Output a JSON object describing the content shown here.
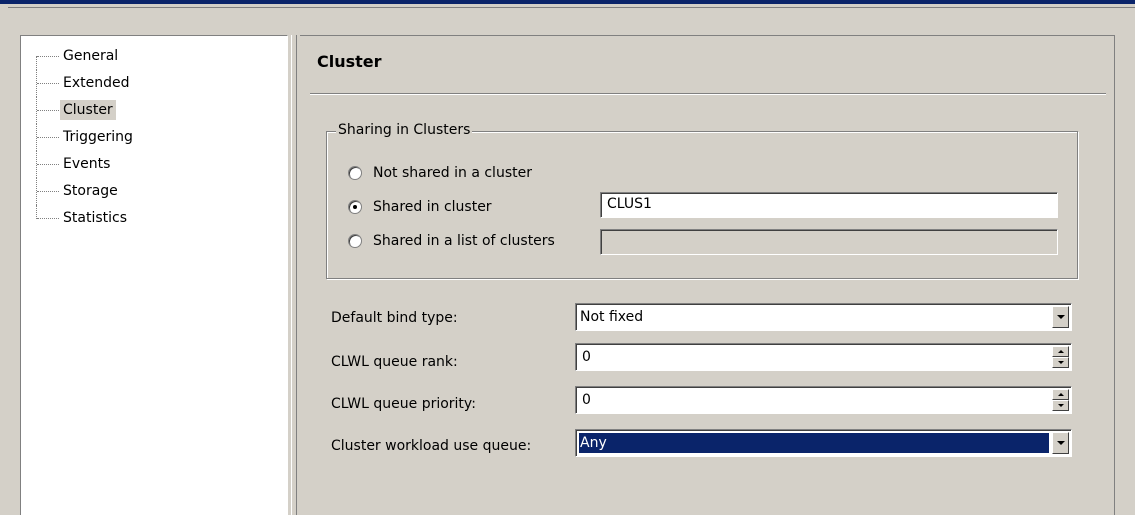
{
  "tree": {
    "items": [
      {
        "label": "General"
      },
      {
        "label": "Extended"
      },
      {
        "label": "Cluster"
      },
      {
        "label": "Triggering"
      },
      {
        "label": "Events"
      },
      {
        "label": "Storage"
      },
      {
        "label": "Statistics"
      }
    ],
    "selected": "Cluster"
  },
  "panel": {
    "title": "Cluster",
    "sharing": {
      "legend": "Sharing in Clusters",
      "options": [
        {
          "label": "Not shared in a cluster",
          "checked": false
        },
        {
          "label": "Shared in cluster",
          "checked": true
        },
        {
          "label": "Shared in a list of clusters",
          "checked": false
        }
      ],
      "cluster_name_value": "CLUS1",
      "cluster_list_value": ""
    },
    "fields": {
      "default_bind_type": {
        "label": "Default bind type:",
        "value": "Not fixed"
      },
      "clwl_queue_rank": {
        "label": "CLWL queue rank:",
        "value": "0"
      },
      "clwl_queue_priority": {
        "label": "CLWL queue priority:",
        "value": "0"
      },
      "cluster_workload_use_queue": {
        "label": "Cluster workload use queue:",
        "value": "Any"
      }
    }
  },
  "colors": {
    "window_bg": "#d4d0c8",
    "selection": "#0a246a"
  }
}
